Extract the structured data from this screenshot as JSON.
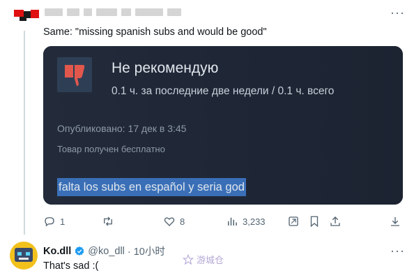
{
  "top_tweet": {
    "more_glyph": "···",
    "text": "Same: \"missing spanish subs and would be good\""
  },
  "media": {
    "review_title": "Не рекомендую",
    "hours": "0.1 ч. за последние две недели / 0.1 ч. всего",
    "published": "Опубликовано: 17 дек в 3:45",
    "free_product": "Товар получен бесплатно",
    "body": "falta los subs en español y seria god",
    "highlight_color": "#3a6fb7"
  },
  "actions": {
    "reply_count": "1",
    "like_count": "8",
    "view_count": "3,233"
  },
  "reply": {
    "name": "Ko.dll",
    "handle": "@ko_dll",
    "time": "· 10小时",
    "text": "That's sad :(",
    "more_glyph": "···"
  },
  "watermark": {
    "text": "游城仓"
  },
  "colors": {
    "accent_blue": "#1d9bf0",
    "muted": "#536471"
  }
}
